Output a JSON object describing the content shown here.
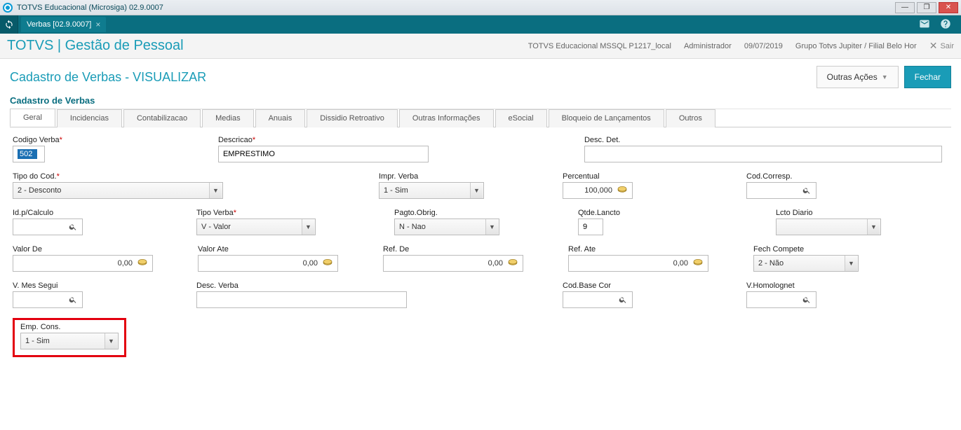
{
  "app_title": "TOTVS Educacional (Microsiga) 02.9.0007",
  "doc_tab": "Verbas [02.9.0007]",
  "module_title": "TOTVS | Gestão de Pessoal",
  "statusbar": {
    "env": "TOTVS Educacional MSSQL P1217_local",
    "user": "Administrador",
    "date": "09/07/2019",
    "group": "Grupo Totvs Jupiter / Filial Belo Hor",
    "exit": "Sair"
  },
  "page": {
    "title": "Cadastro de Verbas - VISUALIZAR",
    "subtitle": "Cadastro de Verbas",
    "actions": {
      "other": "Outras Ações",
      "close": "Fechar"
    }
  },
  "tabs": [
    "Geral",
    "Incidencias",
    "Contabilizacao",
    "Medias",
    "Anuais",
    "Dissidio Retroativo",
    "Outras Informações",
    "eSocial",
    "Bloqueio de Lançamentos",
    "Outros"
  ],
  "labels": {
    "codigo_verba": "Codigo Verba",
    "descricao": "Descricao",
    "desc_det": "Desc. Det.",
    "tipo_cod": "Tipo do Cod.",
    "impr_verba": "Impr. Verba",
    "percentual": "Percentual",
    "cod_corresp": "Cod.Corresp.",
    "id_calculo": "Id.p/Calculo",
    "tipo_verba": "Tipo Verba",
    "pagto_obrig": "Pagto.Obrig.",
    "qtde_lancto": "Qtde.Lancto",
    "lcto_diario": "Lcto Diario",
    "valor_de": "Valor De",
    "valor_ate": "Valor Ate",
    "ref_de": "Ref. De",
    "ref_ate": "Ref. Ate",
    "fech_compete": "Fech Compete",
    "v_mes_segui": "V. Mes Segui",
    "desc_verba": "Desc. Verba",
    "cod_base_cor": "Cod.Base Cor",
    "v_homolognet": "V.Homolognet",
    "emp_cons": "Emp. Cons."
  },
  "values": {
    "codigo_verba": "502",
    "descricao": "EMPRESTIMO",
    "desc_det": "",
    "tipo_cod": "2 - Desconto",
    "impr_verba": "1 - Sim",
    "percentual": "100,000",
    "cod_corresp": "",
    "id_calculo": "",
    "tipo_verba": "V - Valor",
    "pagto_obrig": "N - Nao",
    "qtde_lancto": "9",
    "lcto_diario": "",
    "valor_de": "0,00",
    "valor_ate": "0,00",
    "ref_de": "0,00",
    "ref_ate": "0,00",
    "fech_compete": "2 - Não",
    "v_mes_segui": "",
    "desc_verba": "",
    "cod_base_cor": "",
    "v_homolognet": "",
    "emp_cons": "1 - Sim"
  }
}
